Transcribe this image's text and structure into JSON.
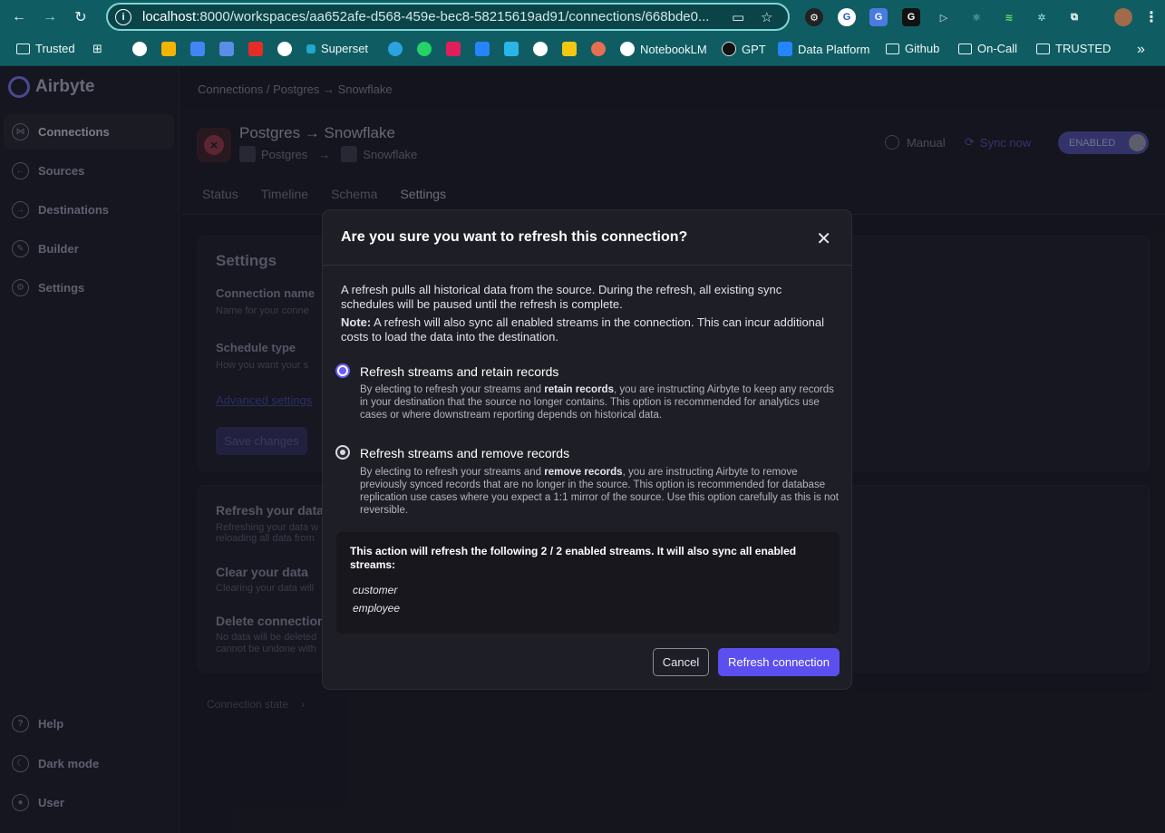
{
  "browser": {
    "url_host": "localhost",
    "url_rest": ":8000/workspaces/aa652afe-d568-459e-bec8-58215619ad91/connections/668bde0...",
    "bookmarks": [
      "Trusted",
      "Superset",
      "NotebookLM",
      "GPT",
      "Data Platform",
      "Github",
      "On-Call",
      "TRUSTED"
    ]
  },
  "sidebar": {
    "brand": "Airbyte",
    "items": [
      "Connections",
      "Sources",
      "Destinations",
      "Builder",
      "Settings"
    ],
    "bottom": [
      "Help",
      "Dark mode",
      "User"
    ]
  },
  "breadcrumb": "Connections  /  Postgres → Snowflake",
  "connection": {
    "title": "Postgres → Snowflake",
    "source": "Postgres",
    "arrow": "→",
    "destination": "Snowflake",
    "schedule": "Manual",
    "sync_now": "Sync now",
    "toggle": "ENABLED"
  },
  "tabs": [
    "Status",
    "Timeline",
    "Schema",
    "Settings"
  ],
  "settings_card": {
    "title": "Settings",
    "connection_name_label": "Connection name",
    "connection_name_sub": "Name for your conne",
    "schedule_label": "Schedule type",
    "schedule_sub": "How you want your s",
    "advanced": "Advanced settings",
    "save": "Save changes"
  },
  "danger_card": {
    "refresh_label": "Refresh your data",
    "refresh_sub1": "Refreshing your data w",
    "refresh_sub2": "reloading all data from",
    "clear_label": "Clear your data",
    "clear_sub": "Clearing your data will",
    "delete_label": "Delete connection",
    "delete_sub1": "No data will be deleted",
    "delete_sub2": "cannot be undone with"
  },
  "connection_state": "Connection state",
  "modal": {
    "title": "Are you sure you want to refresh this connection?",
    "close": "✕",
    "intro": "A refresh pulls all historical data from the source. During the refresh, all existing sync schedules will be paused until the refresh is complete.",
    "note_label": "Note:",
    "note_text": " A refresh will also sync all enabled streams in the connection. This can incur additional costs to load the data into the destination.",
    "option1": {
      "title": "Refresh streams and retain records",
      "desc_a": "By electing to refresh your streams and ",
      "desc_b": "retain records",
      "desc_c": ", you are instructing Airbyte to keep any records in your destination that the source no longer contains. This option is recommended for analytics use cases or where downstream reporting depends on historical data."
    },
    "option2": {
      "title": "Refresh streams and remove records",
      "desc_a": "By electing to refresh your streams and ",
      "desc_b": "remove records",
      "desc_c": ", you are instructing Airbyte to remove previously synced records that are no longer in the source. This option is recommended for database replication use cases where you expect a 1:1 mirror of the source. Use this option carefully as this is not reversible."
    },
    "streams_heading": "This action will refresh the following 2 / 2 enabled streams. It will also sync all enabled streams:",
    "streams": [
      "customer",
      "employee"
    ],
    "cancel": "Cancel",
    "confirm": "Refresh connection"
  }
}
